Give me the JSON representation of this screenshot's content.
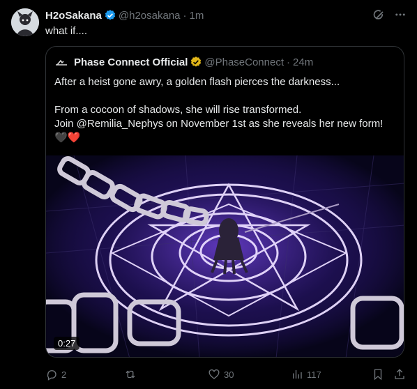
{
  "tweet": {
    "author_name": "H2oSakana",
    "author_handle": "@h2osakana",
    "time": "1m",
    "separator": "·",
    "text": "what if...."
  },
  "quote": {
    "author_name": "Phase Connect Official",
    "author_handle": "@PhaseConnect",
    "time": "24m",
    "separator": "·",
    "line1": "After a heist gone awry, a golden flash pierces the darkness...",
    "line2": "From a cocoon of shadows, she will rise transformed.",
    "line3": "Join @Remilia_Nephys on November 1st as she reveals her new form!",
    "emojis": "🖤❤️",
    "video_duration": "0:27"
  },
  "actions": {
    "replies": "2",
    "reposts": "",
    "likes": "30",
    "views": "117"
  },
  "colors": {
    "verified_blue": "#1d9bf0",
    "verified_gold": "#e2b719",
    "muted": "#71767b",
    "text": "#e7e9ea",
    "border": "#2f3336"
  },
  "icons": [
    "grok-icon",
    "more-icon",
    "reply-icon",
    "repost-icon",
    "like-icon",
    "views-icon",
    "bookmark-icon",
    "share-icon"
  ]
}
